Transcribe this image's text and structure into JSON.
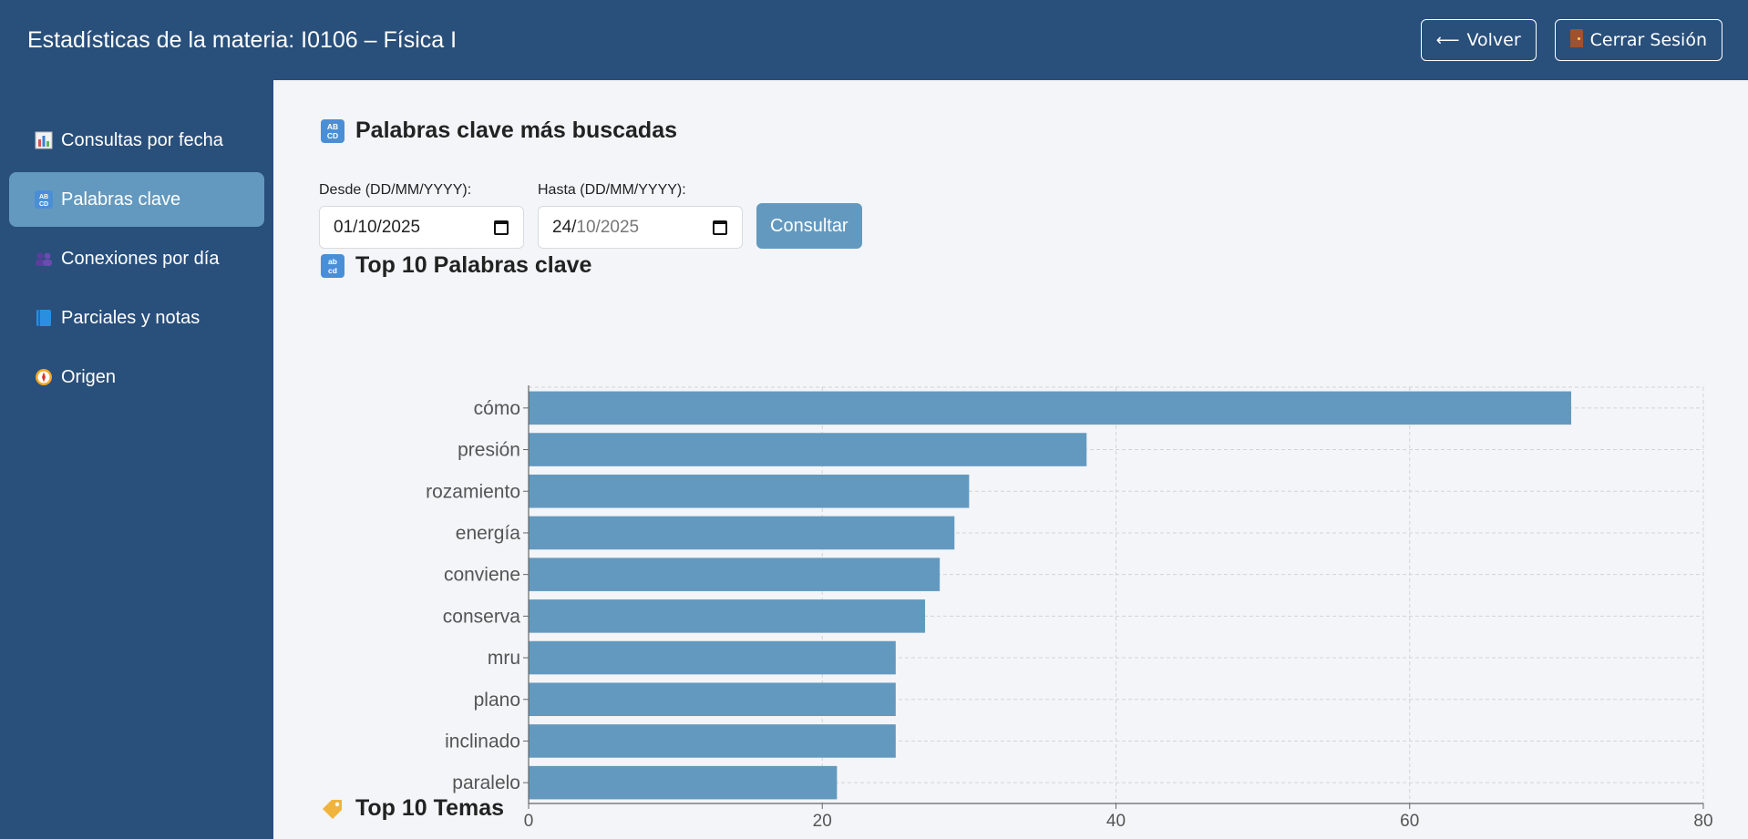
{
  "header": {
    "title": "Estadísticas de la materia: I0106 – Física I",
    "back_label": "Volver",
    "back_icon": "arrow-left-icon",
    "logout_label": "Cerrar Sesión",
    "logout_icon": "door-icon"
  },
  "sidebar": {
    "items": [
      {
        "label": "Consultas por fecha",
        "icon": "bar-chart-icon",
        "active": false
      },
      {
        "label": "Palabras clave",
        "icon": "abcd-icon",
        "active": true
      },
      {
        "label": "Conexiones por día",
        "icon": "people-icon",
        "active": false
      },
      {
        "label": "Parciales y notas",
        "icon": "book-icon",
        "active": false
      },
      {
        "label": "Origen",
        "icon": "compass-icon",
        "active": false
      }
    ]
  },
  "main": {
    "section_title": "Palabras clave más buscadas",
    "from_label": "Desde (DD/MM/YYYY):",
    "from_day": "01/",
    "from_rest": "10/2025",
    "to_label": "Hasta (DD/MM/YYYY):",
    "to_day": "24/",
    "to_rest": "10/2025",
    "submit_label": "Consultar",
    "chart_title": "Top 10 Palabras clave",
    "next_section_title": "Top 10 Temas"
  },
  "colors": {
    "header_bg": "#294f7b",
    "sidebar_active": "#6399bf",
    "bar": "#6399bf",
    "page_bg": "#f3f5f8"
  },
  "chart_data": {
    "type": "bar",
    "orientation": "horizontal",
    "categories": [
      "cómo",
      "presión",
      "rozamiento",
      "energía",
      "conviene",
      "conserva",
      "mru",
      "plano",
      "inclinado",
      "paralelo"
    ],
    "values": [
      71,
      38,
      30,
      29,
      28,
      27,
      25,
      25,
      25,
      21
    ],
    "xlim": [
      0,
      80
    ],
    "xticks": [
      0,
      20,
      40,
      60,
      80
    ],
    "grid": true
  }
}
